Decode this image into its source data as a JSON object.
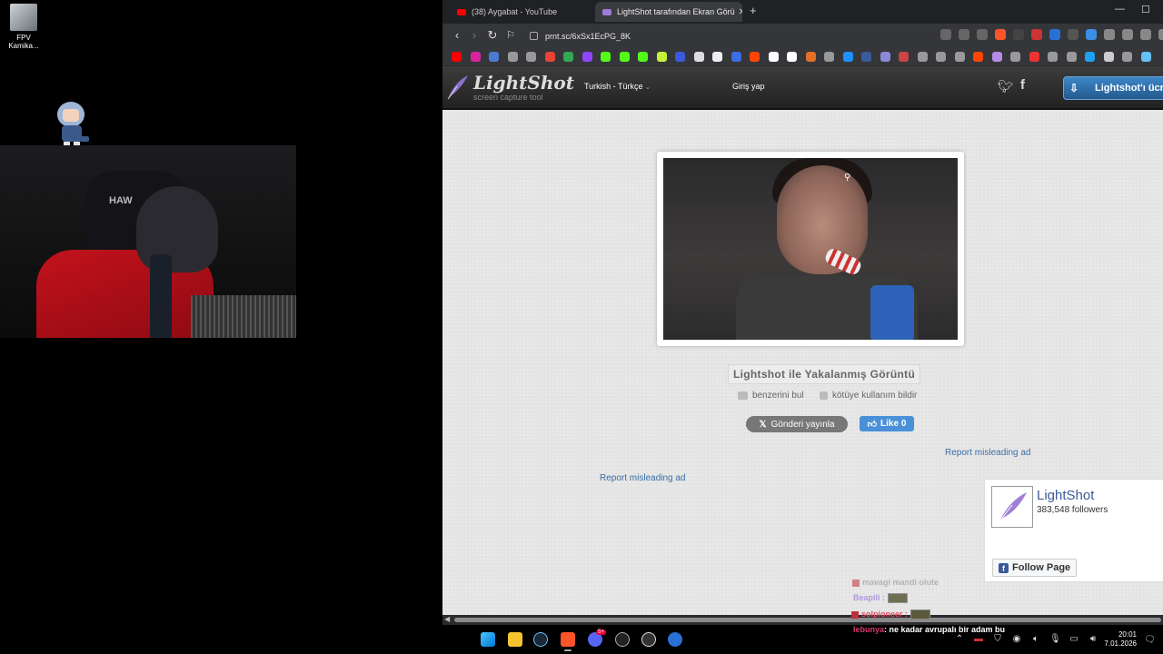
{
  "desktop": {
    "icon_label": "FPV\nKamika..."
  },
  "browser": {
    "tabs": [
      {
        "label": "(38) Aygabat - YouTube"
      },
      {
        "label": "LightShot tarafından Ekran Görü"
      }
    ],
    "new_tab_glyph": "+",
    "tab_close_glyph": "✕",
    "url": "prnt.sc/6xSx1EcPG_8K"
  },
  "lightshot": {
    "logo_text": "LightShot",
    "logo_subtitle": "screen capture tool",
    "language": "Turkish - Türkçe",
    "login": "Giriş yap",
    "download_button": "Lightshot'ı ücr",
    "image_title": "Lightshot ile Yakalanmış Görüntü",
    "find_similar": "benzerini bul",
    "report_abuse": "kötüye kullanım bildir",
    "tweet_button": "Gönderi yayınla",
    "like_button": "Like 0",
    "report_ad_1": "Report misleading ad",
    "report_ad_2": "Report misleading ad",
    "facebook": {
      "page_name": "LightShot",
      "followers": "383,548 followers",
      "follow_button": "Follow Page"
    }
  },
  "chat": [
    {
      "user": "mavagi",
      "message": "mandi olute"
    },
    {
      "user": "Beaplli :",
      "message": ""
    },
    {
      "user": "solpioneer",
      "message": ":"
    },
    {
      "user": "lebunya",
      "message": ": ne kadar avrupalı bir adam bu"
    }
  ],
  "taskbar": {
    "discord_badge": "5+",
    "time": "20:01",
    "date": "7.01.2026"
  },
  "colors": {
    "browser_chrome": "#202124",
    "toolbar": "#35363a",
    "lightshot_header": "#2c2c2c",
    "download_blue": "#2f6fad",
    "link_blue": "#3a6ea5",
    "facebook_blue": "#3b5998"
  }
}
